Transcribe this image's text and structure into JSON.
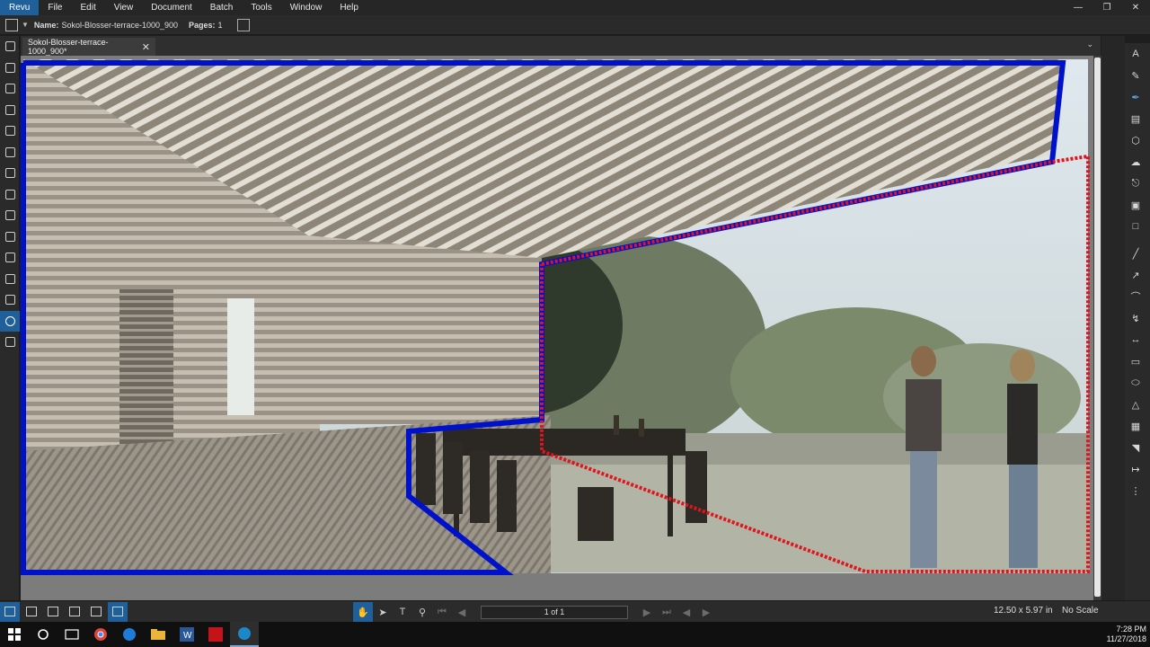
{
  "menu": {
    "items": [
      "Revu",
      "File",
      "Edit",
      "View",
      "Document",
      "Batch",
      "Tools",
      "Window",
      "Help"
    ],
    "window_controls": [
      "minimize",
      "restore",
      "close"
    ]
  },
  "properties": {
    "name_label": "Name:",
    "name_value": "Sokol-Blosser-terrace-1000_900",
    "pages_label": "Pages:",
    "pages_value": "1"
  },
  "tab": {
    "title": "Sokol-Blosser-terrace-1000_900*",
    "close": "✕"
  },
  "canvas": {
    "markup_blue": "#0011cc",
    "markup_red": "#e0141c"
  },
  "left_panel_icons": [
    "thumbnails-icon",
    "bookmarks-icon",
    "layers-icon",
    "file-access-icon",
    "signatures-icon",
    "links-icon",
    "settings-icon",
    "measurements-icon",
    "markups-list-icon",
    "tool-chest-icon",
    "properties-icon",
    "stamp-icon",
    "search-icon",
    "sets-icon"
  ],
  "right_tools": [
    "text-icon",
    "highlight-icon",
    "pen-icon",
    "callout-icon",
    "polygon-icon",
    "cloud-icon",
    "stamp-icon",
    "image-icon",
    "snapshot-icon",
    "line-icon",
    "arrow-icon",
    "arc-icon",
    "polyline-icon",
    "dimension-icon",
    "rectangle-icon",
    "ellipse-icon",
    "area-icon",
    "sketch-icon",
    "crop-icon",
    "measure-icon",
    "count-icon"
  ],
  "status": {
    "page_field": "1 of 1",
    "dimensions": "12.50 x 5.97 in",
    "scale": "No Scale"
  },
  "taskbar": {
    "time": "7:28 PM",
    "date": "11/27/2018"
  }
}
